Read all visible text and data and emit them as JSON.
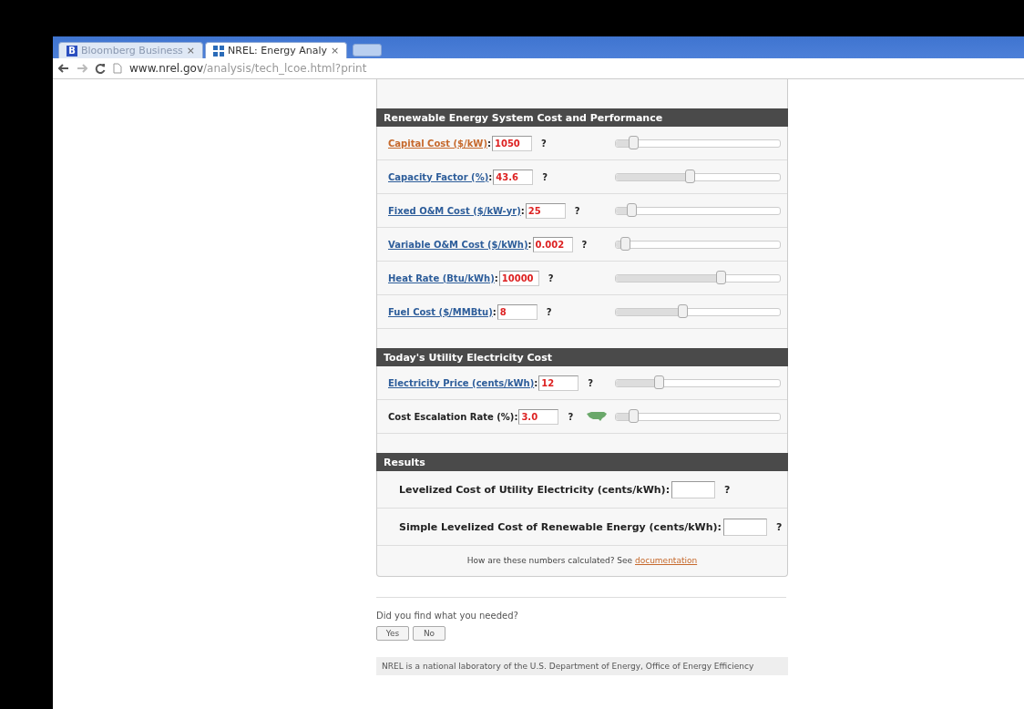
{
  "browser": {
    "tabs": [
      {
        "title": "Bloomberg Business",
        "close": "×",
        "selected": false,
        "icon_letter": "B"
      },
      {
        "title": "NREL: Energy Analy",
        "close": "×",
        "selected": true
      }
    ],
    "address": {
      "domain": "www.nrel.gov",
      "path": "/analysis/tech_lcoe.html?print"
    }
  },
  "sections": [
    {
      "title": "Renewable Energy System Cost and Performance",
      "rows": [
        {
          "kind": "visited",
          "label": "Capital Cost ($/kW)",
          "suffix": ":",
          "value": "1050",
          "help": "?",
          "has_map": false,
          "level": 0.08
        },
        {
          "kind": "link",
          "label": "Capacity Factor (%)",
          "suffix": ":",
          "value": "43.6",
          "help": "?",
          "has_map": false,
          "level": 0.45
        },
        {
          "kind": "link",
          "label": "Fixed O&M Cost ($/kW-yr)",
          "suffix": ":",
          "value": "25",
          "help": "?",
          "has_map": false,
          "level": 0.07
        },
        {
          "kind": "link",
          "label": "Variable O&M Cost ($/kWh)",
          "suffix": ":",
          "value": "0.002",
          "help": "?",
          "has_map": false,
          "level": 0.03
        },
        {
          "kind": "link",
          "label": "Heat Rate (Btu/kWh)",
          "suffix": ":",
          "value": "10000",
          "help": "?",
          "has_map": false,
          "level": 0.65
        },
        {
          "kind": "link",
          "label": "Fuel Cost ($/MMBtu)",
          "suffix": ":",
          "value": "8",
          "help": "?",
          "has_map": false,
          "level": 0.4
        }
      ]
    },
    {
      "title": "Today's Utility Electricity Cost",
      "rows": [
        {
          "kind": "link",
          "label": "Electricity Price (cents/kWh)",
          "suffix": ":",
          "value": "12",
          "help": "?",
          "has_map": false,
          "level": 0.25
        },
        {
          "kind": "plain",
          "label": "Cost Escalation Rate (%)",
          "suffix": ":",
          "value": "3.0",
          "help": "?",
          "has_map": true,
          "level": 0.08
        }
      ]
    },
    {
      "title": "Results",
      "rows": [
        {
          "kind": "result",
          "label": "Levelized Cost of Utility Electricity (cents/kWh):",
          "help": "?"
        },
        {
          "kind": "result",
          "label": "Simple Levelized Cost of Renewable Energy (cents/kWh):",
          "help": "?"
        }
      ]
    }
  ],
  "note": {
    "text": "How are these numbers calculated? See ",
    "link": "documentation"
  },
  "feedback": {
    "question": "Did you find what you needed?",
    "buttons": [
      "Yes",
      "No"
    ]
  },
  "footer": {
    "text": "NREL is a national laboratory of the U.S. Department of Energy, Office of Energy Efficiency"
  }
}
